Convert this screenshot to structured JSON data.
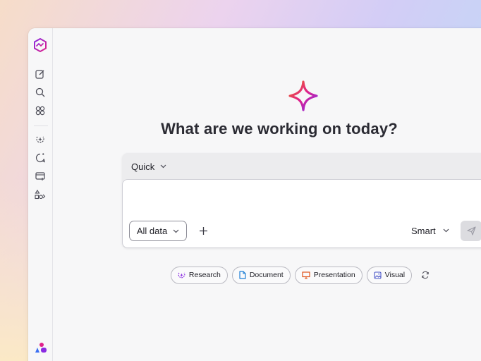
{
  "app": {
    "accent_colors": {
      "brand": "#e0218a",
      "purple": "#8a2be2",
      "orange": "#f57c00"
    }
  },
  "sidebar": {
    "items": [
      {
        "icon": "logo-icon"
      },
      {
        "icon": "new-chat-icon"
      },
      {
        "icon": "search-icon"
      },
      {
        "icon": "agents-icon"
      },
      {
        "icon": "research-icon"
      },
      {
        "icon": "chat-history-icon"
      },
      {
        "icon": "workspace-add-icon"
      },
      {
        "icon": "apps-icon"
      }
    ]
  },
  "main": {
    "headline": "What are we working on today?",
    "composer": {
      "mode_label": "Quick",
      "input_placeholder": "",
      "data_scope_label": "All data",
      "model_label": "Smart"
    },
    "suggestions": [
      {
        "label": "Research",
        "icon": "research-icon",
        "color": "#8a2be2"
      },
      {
        "label": "Document",
        "icon": "document-icon",
        "color": "#1e7fd6"
      },
      {
        "label": "Presentation",
        "icon": "presentation-icon",
        "color": "#e0521a"
      },
      {
        "label": "Visual",
        "icon": "image-icon",
        "color": "#4a56c8"
      }
    ]
  }
}
